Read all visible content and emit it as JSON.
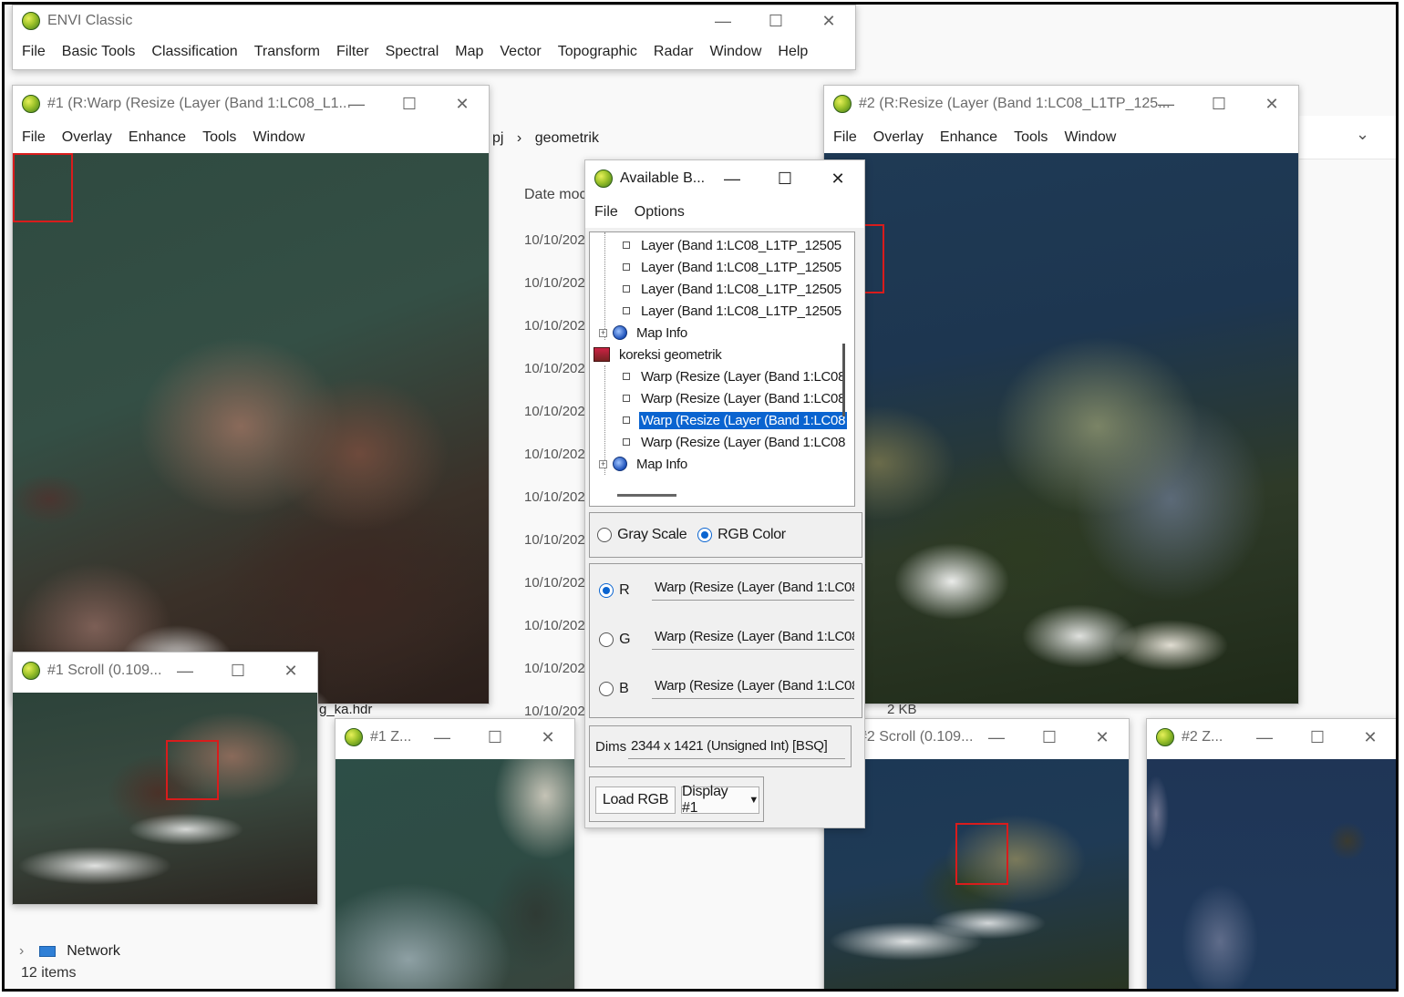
{
  "envi_classic": {
    "title": "ENVI Classic",
    "menu": [
      "File",
      "Basic Tools",
      "Classification",
      "Transform",
      "Filter",
      "Spectral",
      "Map",
      "Vector",
      "Topographic",
      "Radar",
      "Window",
      "Help"
    ]
  },
  "explorer": {
    "path": [
      "pj",
      "›",
      "geometrik"
    ],
    "date_header": "Date moc",
    "dates": [
      "10/10/202",
      "10/10/202",
      "10/10/202",
      "10/10/202",
      "10/10/202",
      "10/10/202",
      "10/10/202",
      "10/10/202",
      "10/10/202",
      "10/10/202",
      "10/10/202",
      "10/10/202"
    ],
    "file_name": "g_ka.hdr",
    "file_size": "2 KB",
    "network": "Network",
    "item_count": "12 items",
    "chevron": "⌄"
  },
  "display1": {
    "title": "#1 (R:Warp (Resize (Layer (Band 1:LC08_L1...",
    "menu": [
      "File",
      "Overlay",
      "Enhance",
      "Tools",
      "Window"
    ]
  },
  "display2": {
    "title": "#2 (R:Resize (Layer (Band 1:LC08_L1TP_125...",
    "menu": [
      "File",
      "Overlay",
      "Enhance",
      "Tools",
      "Window"
    ]
  },
  "scroll1": {
    "title": "#1 Scroll (0.109..."
  },
  "scroll2": {
    "title": "#2 Scroll (0.109..."
  },
  "zoom1": {
    "title": "#1 Z..."
  },
  "zoom2": {
    "title": "#2 Z..."
  },
  "bands": {
    "title": "Available B...",
    "menu": [
      "File",
      "Options"
    ],
    "tree": {
      "layer1": "Layer (Band 1:LC08_L1TP_12505",
      "layer2": "Layer (Band 1:LC08_L1TP_12505",
      "layer3": "Layer (Band 1:LC08_L1TP_12505",
      "layer4": "Layer (Band 1:LC08_L1TP_12505",
      "mapinfo1": "Map Info",
      "group": "koreksi geometrik",
      "warp1": "Warp (Resize (Layer (Band 1:LC08",
      "warp2": "Warp (Resize (Layer (Band 1:LC08",
      "warp3": "Warp (Resize (Layer (Band 1:LC08",
      "warp4": "Warp (Resize (Layer (Band 1:LC08",
      "mapinfo2": "Map Info"
    },
    "gray_scale": "Gray Scale",
    "rgb_color": "RGB Color",
    "r_label": "R",
    "g_label": "G",
    "b_label": "B",
    "r_value": "Warp (Resize (Layer (Band 1:LC08",
    "g_value": "Warp (Resize (Layer (Band 1:LC08",
    "b_value": "Warp (Resize (Layer (Band 1:LC08",
    "dims_label": "Dims",
    "dims_value": "2344 x 1421 (Unsigned Int) [BSQ]",
    "load_rgb": "Load RGB",
    "display_select": "Display #1"
  },
  "window_controls": {
    "minimize": "—",
    "maximize": "☐",
    "close": "✕"
  }
}
